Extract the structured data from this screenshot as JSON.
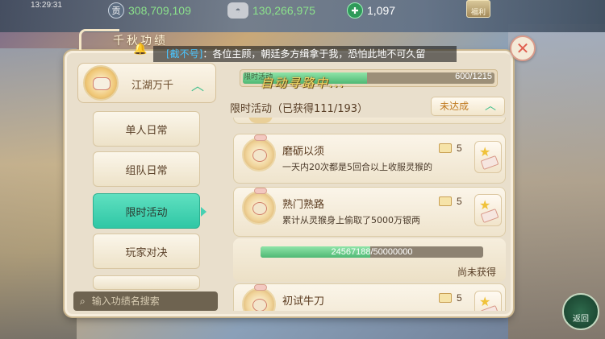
{
  "status_bar": {
    "time": "13:29:31"
  },
  "currencies": [
    {
      "icon": "tael-coin-icon",
      "glyph": "贡",
      "value": "308,709,109"
    },
    {
      "icon": "silver-ingot-icon",
      "glyph": "◓",
      "value": "130,266,975"
    },
    {
      "icon": "jade-gem-icon",
      "glyph": "✚",
      "value": "1,097"
    }
  ],
  "top_chest_label": "福利",
  "panel": {
    "title": "千秋功绩"
  },
  "broadcast": {
    "sender": "[截不号]",
    "message": "：各位主顾，朝廷多方缉拿于我，恐怕此地不可久留"
  },
  "sidebar": {
    "category": "江湖万千",
    "items": [
      {
        "label": "单人日常",
        "active": false
      },
      {
        "label": "组队日常",
        "active": false
      },
      {
        "label": "限时活动",
        "active": true
      },
      {
        "label": "玩家对决",
        "active": false
      }
    ]
  },
  "search": {
    "placeholder": "输入功绩名搜索"
  },
  "category_progress": {
    "label": "限时活动",
    "count": "600/1215",
    "fraction": 0.494
  },
  "tutorial_text": "自动寻路中...",
  "section": {
    "title": "限时活动（已获得111/193）"
  },
  "filter": {
    "label": "未达成"
  },
  "achievements": [
    {
      "name": "磨砺以须",
      "desc": "一天内20次都是5回合以上收服灵猴的",
      "points": "5"
    },
    {
      "name": "熟门熟路",
      "desc": "累计从灵猴身上偷取了5000万银两",
      "points": "5"
    },
    {
      "name": "初试牛刀",
      "desc": "",
      "points": "5"
    }
  ],
  "progress": {
    "text": "24567188/50000000",
    "fraction": 0.491,
    "status": "尚未获得"
  },
  "return_button": {
    "label": "返回"
  },
  "colors": {
    "accent_green": "#3fbf8c",
    "active_tab": "#46d0b2",
    "panel_bg": "#e9dfcc",
    "broadcast_name": "#49c4ff"
  }
}
